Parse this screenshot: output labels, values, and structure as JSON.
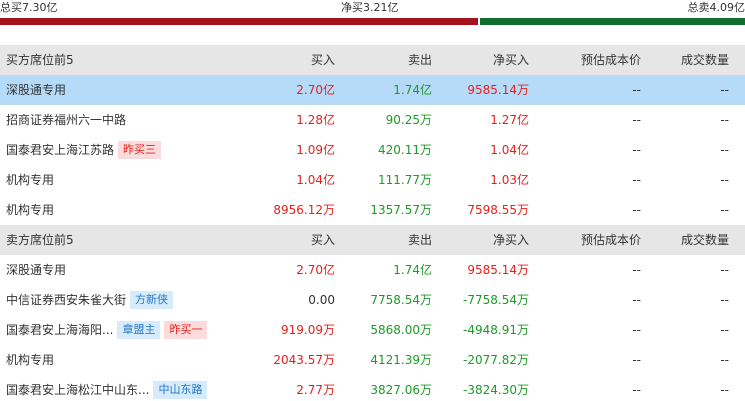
{
  "summary": {
    "total_buy": "总买7.30亿",
    "net_buy": "净买3.21亿",
    "total_sell": "总卖4.09亿",
    "buy_share": 0.641,
    "colors": {
      "buy": "#a3131b",
      "sell": "#116e2e"
    }
  },
  "columns": {
    "buy": "买入",
    "sell": "卖出",
    "net": "净买入",
    "cost": "预估成本价",
    "qty": "成交数量"
  },
  "buy_section": {
    "title": "买方席位前5",
    "rows": [
      {
        "name": "深股通专用",
        "tags": [],
        "buy": "2.70亿",
        "sell": "1.74亿",
        "net": "9585.14万",
        "cost": "--",
        "qty": "--",
        "highlight": true
      },
      {
        "name": "招商证券福州六一中路",
        "tags": [],
        "buy": "1.28亿",
        "sell": "90.25万",
        "net": "1.27亿",
        "cost": "--",
        "qty": "--"
      },
      {
        "name": "国泰君安上海江苏路",
        "tags": [
          {
            "text": "昨买三",
            "style": "pink"
          }
        ],
        "buy": "1.09亿",
        "sell": "420.11万",
        "net": "1.04亿",
        "cost": "--",
        "qty": "--"
      },
      {
        "name": "机构专用",
        "tags": [],
        "buy": "1.04亿",
        "sell": "111.77万",
        "net": "1.03亿",
        "cost": "--",
        "qty": "--"
      },
      {
        "name": "机构专用",
        "tags": [],
        "buy": "8956.12万",
        "sell": "1357.57万",
        "net": "7598.55万",
        "cost": "--",
        "qty": "--"
      }
    ]
  },
  "sell_section": {
    "title": "卖方席位前5",
    "rows": [
      {
        "name": "深股通专用",
        "tags": [],
        "buy": "2.70亿",
        "sell": "1.74亿",
        "net": "9585.14万",
        "cost": "--",
        "qty": "--",
        "net_color": "red",
        "buy_color": "red"
      },
      {
        "name": "中信证券西安朱雀大街",
        "tags": [
          {
            "text": "方新侠",
            "style": "blue"
          }
        ],
        "buy": "0.00",
        "sell": "7758.54万",
        "net": "-7758.54万",
        "cost": "--",
        "qty": "--",
        "net_color": "green",
        "buy_color": "dark"
      },
      {
        "name": "国泰君安上海海阳...",
        "tags": [
          {
            "text": "章盟主",
            "style": "blue"
          },
          {
            "text": "昨买一",
            "style": "pink"
          }
        ],
        "buy": "919.09万",
        "sell": "5868.00万",
        "net": "-4948.91万",
        "cost": "--",
        "qty": "--",
        "net_color": "green",
        "buy_color": "red"
      },
      {
        "name": "机构专用",
        "tags": [],
        "buy": "2043.57万",
        "sell": "4121.39万",
        "net": "-2077.82万",
        "cost": "--",
        "qty": "--",
        "net_color": "green",
        "buy_color": "red"
      },
      {
        "name": "国泰君安上海松江中山东...",
        "tags": [
          {
            "text": "中山东路",
            "style": "blue"
          }
        ],
        "buy": "2.77万",
        "sell": "3827.06万",
        "net": "-3824.30万",
        "cost": "--",
        "qty": "--",
        "net_color": "green",
        "buy_color": "red"
      }
    ]
  }
}
